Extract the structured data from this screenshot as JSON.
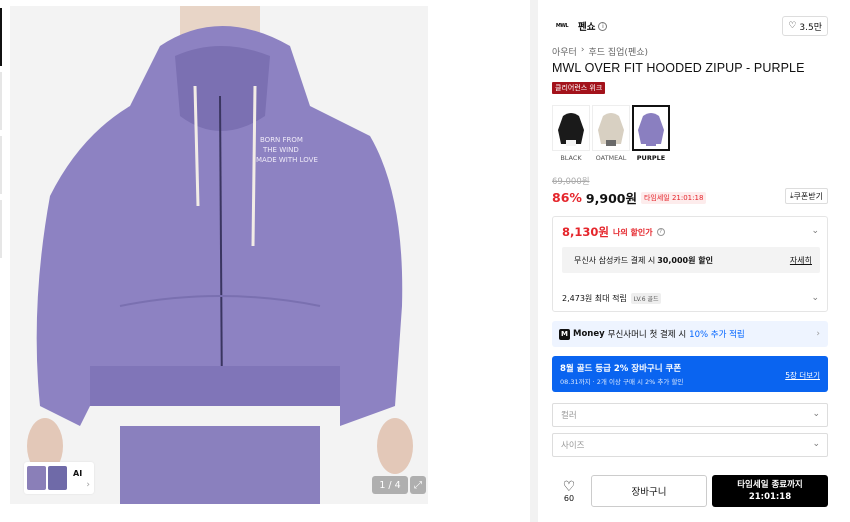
{
  "gallery": {
    "counter": "1 / 4",
    "ai_label": "AI",
    "print_text": [
      "BORN FROM",
      "THE WIND",
      "MADE WITH LOVE"
    ]
  },
  "brand": {
    "logo_text": "MWL",
    "name": "펜쇼",
    "like_count": "3.5만"
  },
  "breadcrumb": [
    "아우터",
    "후드 집업(펜쇼)"
  ],
  "product": {
    "title": "MWL OVER FIT HOODED ZIPUP - PURPLE",
    "badge": "클리어런스 위크",
    "colors": [
      {
        "label": "BLACK",
        "color": "#1a1a1a",
        "selected": false
      },
      {
        "label": "OATMEAL",
        "color": "#d8d0c2",
        "selected": false
      },
      {
        "label": "PURPLE",
        "color": "#8a7fc0",
        "selected": true
      }
    ],
    "original_price": "69,000원",
    "discount": "86%",
    "price": "9,900원",
    "timesale": "타임세일 21:01:18",
    "coupon_button": "쿠폰받기"
  },
  "my_discount": {
    "amount": "8,130원",
    "label": "나의 할인가",
    "card_prefix": "무신사 삼성카드 결제 시",
    "card_amount": "30,000원 할인",
    "card_detail": "자세히",
    "points": "2,473원 최대 적립",
    "level": "LV.6 골드"
  },
  "money_bar": {
    "logo": "M",
    "brand": "Money",
    "text": "무신사머니 첫 결제 시",
    "highlight": "10% 추가 적립"
  },
  "coupon_banner": {
    "line1": "8월 골드 등급 2% 장바구니 쿠폰",
    "line2": "08.31까지 · 2개 이상 구매 시 2% 추가 할인",
    "more": "5장 더보기"
  },
  "options": {
    "color_placeholder": "컬러",
    "size_placeholder": "사이즈"
  },
  "actions": {
    "like_count": "60",
    "cart": "장바구니",
    "buy_line1": "타임세일 종료까지",
    "buy_line2": "21:01:18"
  },
  "colors": {
    "accent_red": "#e5262c",
    "accent_blue": "#0a64f0",
    "hoodie": "#8d82c2"
  }
}
